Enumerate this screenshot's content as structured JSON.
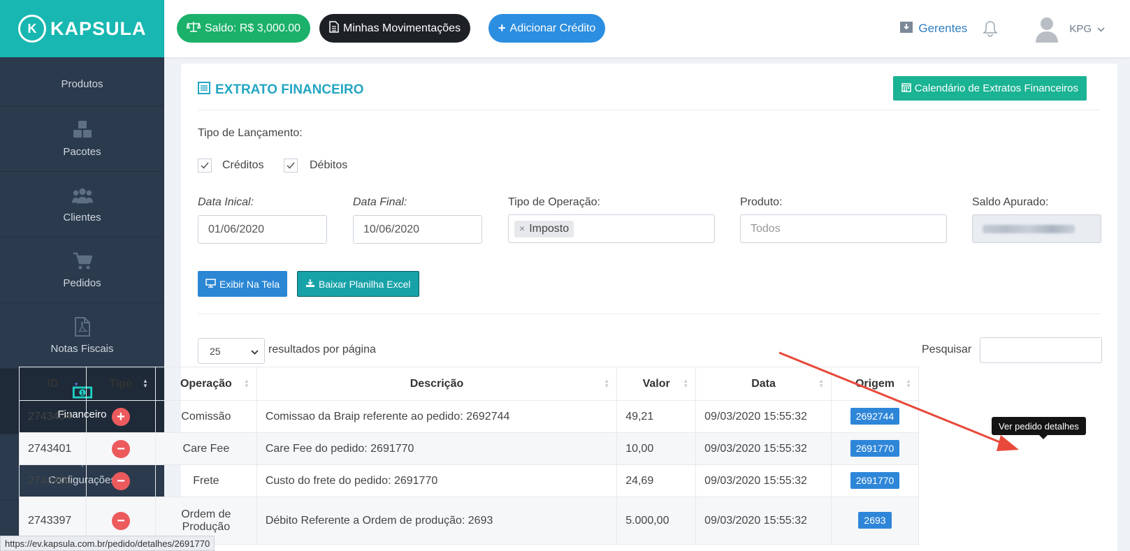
{
  "brand": {
    "logo_letter": "K",
    "name": "KAPSULA"
  },
  "sidebar": {
    "items": [
      {
        "label": "Produtos",
        "icon": "box-icon"
      },
      {
        "label": "Pacotes",
        "icon": "cubes-icon"
      },
      {
        "label": "Clientes",
        "icon": "users-icon"
      },
      {
        "label": "Pedidos",
        "icon": "cart-icon"
      },
      {
        "label": "Notas Fiscais",
        "icon": "pdf-file-icon"
      },
      {
        "label": "Financeiro",
        "icon": "money-icon",
        "active": true
      },
      {
        "label": "Configurações",
        "icon": "gear-icon"
      },
      {
        "label": "",
        "icon": "notebook-icon"
      }
    ]
  },
  "topbar": {
    "saldo": "Saldo: R$ 3,000.00",
    "movimentacoes": "Minhas Movimentações",
    "adicionar": "Adicionar Crédito",
    "gerentes": "Gerentes",
    "user": "KPG"
  },
  "card": {
    "title": "EXTRATO FINANCEIRO",
    "calendar_button": "Calendário de Extratos Financeiros"
  },
  "filters": {
    "tipo_label": "Tipo de Lançamento:",
    "creditos": "Créditos",
    "debitos": "Débitos",
    "data_inicial_label": "Data Inical:",
    "data_inicial": "01/06/2020",
    "data_final_label": "Data Final:",
    "data_final": "10/06/2020",
    "operacao_label": "Tipo de Operação:",
    "operacao_tag": "Imposto",
    "produto_label": "Produto:",
    "produto_placeholder": "Todos",
    "saldo_label": "Saldo Apurado:"
  },
  "actions": {
    "exibir": "Exibir Na Tela",
    "baixar": "Baixar Planilha Excel"
  },
  "table_controls": {
    "page_size": "25",
    "per_page_text": "resultados por página",
    "search_label": "Pesquisar"
  },
  "table": {
    "headers": [
      "ID",
      "Tipo",
      "Operação",
      "Descrição",
      "Valor",
      "Data",
      "Origem"
    ],
    "rows": [
      {
        "id": "2743404",
        "tipo": "+",
        "operacao": "Comissão",
        "descricao": "Comissao da Braip referente ao pedido: 2692744",
        "valor": "49,21",
        "data": "09/03/2020 15:55:32",
        "origem": "2692744"
      },
      {
        "id": "2743401",
        "tipo": "−",
        "operacao": "Care Fee",
        "descricao": "Care Fee do pedido: 2691770",
        "valor": "10,00",
        "data": "09/03/2020 15:55:32",
        "origem": "2691770"
      },
      {
        "id": "2743400",
        "tipo": "−",
        "operacao": "Frete",
        "descricao": "Custo do frete do pedido: 2691770",
        "valor": "24,69",
        "data": "09/03/2020 15:55:32",
        "origem": "2691770"
      },
      {
        "id": "2743397",
        "tipo": "−",
        "operacao": "Ordem de Produção",
        "descricao": "Débito Referente a Ordem de produção: 2693",
        "valor": "5.000,00",
        "data": "09/03/2020 15:55:32",
        "origem": "2693"
      }
    ]
  },
  "tooltip": "Ver pedido detalhes",
  "status_url": "https://ev.kapsula.com.br/pedido/detalhes/2691770",
  "colors": {
    "brand": "#18b7b1",
    "sidebar": "#2b3a4d",
    "credit": "#1bb16a",
    "debit": "#ec5a5d",
    "primary": "#2e86d8",
    "annotation_arrow": "#e8493a"
  }
}
